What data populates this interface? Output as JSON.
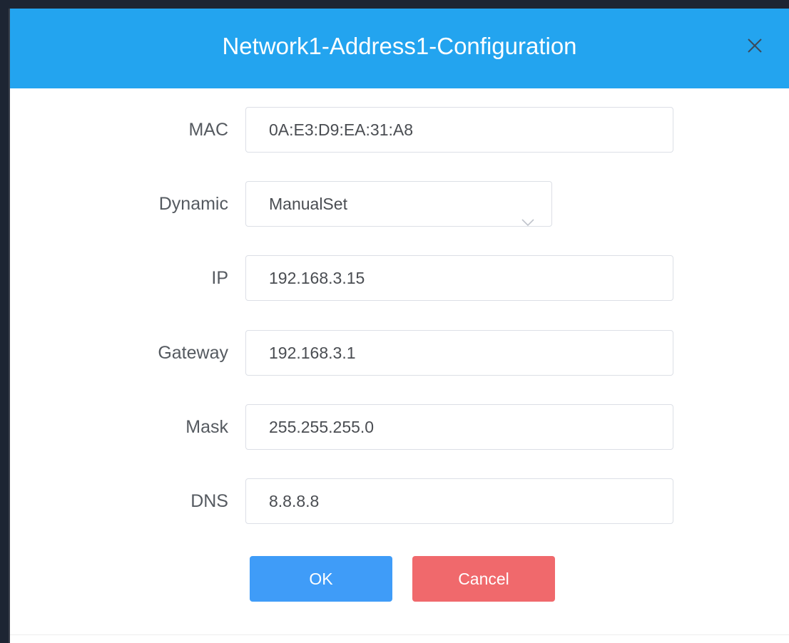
{
  "dialog": {
    "title": "Network1-Address1-Configuration",
    "close_icon": "close-icon"
  },
  "form": {
    "mac": {
      "label": "MAC",
      "value": "0A:E3:D9:EA:31:A8"
    },
    "dynamic": {
      "label": "Dynamic",
      "value": "ManualSet",
      "icon": "chevron-down-icon"
    },
    "ip": {
      "label": "IP",
      "value": "192.168.3.15"
    },
    "gateway": {
      "label": "Gateway",
      "value": "192.168.3.1"
    },
    "mask": {
      "label": "Mask",
      "value": "255.255.255.0"
    },
    "dns": {
      "label": "DNS",
      "value": "8.8.8.8"
    }
  },
  "buttons": {
    "ok_label": "OK",
    "cancel_label": "Cancel"
  },
  "colors": {
    "header_bg": "#23a4ef",
    "ok_bg": "#3f9cf8",
    "cancel_bg": "#f0696c"
  }
}
